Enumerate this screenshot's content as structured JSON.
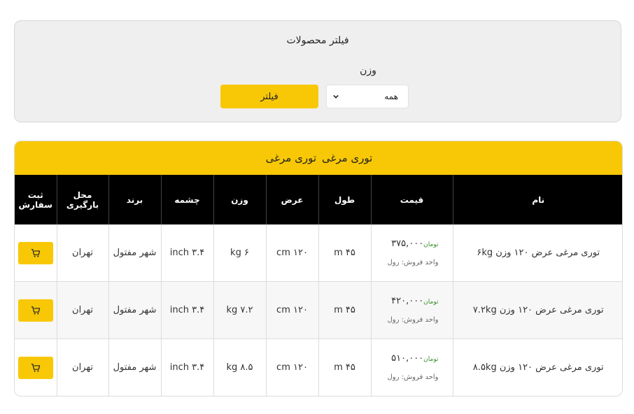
{
  "filter": {
    "title": "فیلتر محصولات",
    "weight_label": "وزن",
    "weight_value": "همه",
    "button_label": "فیلتر"
  },
  "card": {
    "title_1": "توری مرغی",
    "title_2": "توری مرغی"
  },
  "table": {
    "headers": {
      "order": "ثبت سفارش",
      "location": "محل بارگیری",
      "brand": "برند",
      "mesh": "چشمه",
      "weight": "وزن",
      "width": "عرض",
      "length": "طول",
      "price": "قیمت",
      "name": "نام"
    },
    "rows": [
      {
        "name": "توری مرغی عرض ۱۲۰ وزن ۶kg",
        "price": "۳۷۵,۰۰۰",
        "currency": "تومان",
        "unit": "واحد فروش: رول",
        "length": "۴۵ m",
        "width": "۱۲۰ cm",
        "weight": "۶ kg",
        "mesh": "۳.۴ inch",
        "brand": "شهر مفتول",
        "location": "تهران"
      },
      {
        "name": "توری مرغی عرض ۱۲۰ وزن ۷.۲kg",
        "price": "۴۲۰,۰۰۰",
        "currency": "تومان",
        "unit": "واحد فروش: رول",
        "length": "۴۵ m",
        "width": "۱۲۰ cm",
        "weight": "۷.۲ kg",
        "mesh": "۳.۴ inch",
        "brand": "شهر مفتول",
        "location": "تهران"
      },
      {
        "name": "توری مرغی عرض ۱۲۰ وزن ۸.۵kg",
        "price": "۵۱۰,۰۰۰",
        "currency": "تومان",
        "unit": "واحد فروش: رول",
        "length": "۴۵ m",
        "width": "۱۲۰ cm",
        "weight": "۸.۵ kg",
        "mesh": "۳.۴ inch",
        "brand": "شهر مفتول",
        "location": "تهران"
      }
    ]
  },
  "icons": {
    "cart": "cart-icon",
    "select_arrow": "chevron-down-icon"
  },
  "colors": {
    "accent": "#f8c806",
    "header_bg": "#000000",
    "currency": "#3b8f2f"
  }
}
